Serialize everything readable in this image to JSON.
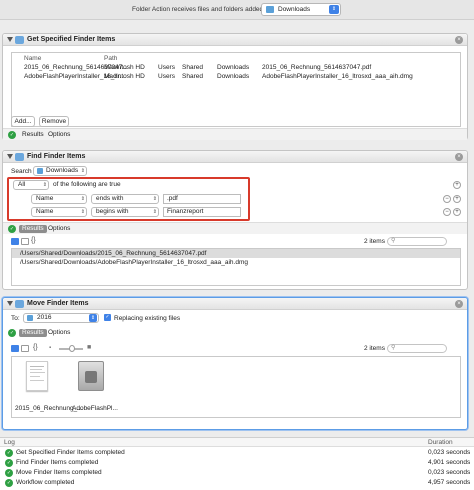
{
  "workflow": {
    "receives_label": "Folder Action receives files and folders added to",
    "receives_target": "Downloads"
  },
  "action1": {
    "title": "Get Specified Finder Items",
    "columns": [
      "Name",
      "Path"
    ],
    "rows": [
      {
        "name": "2015_06_Rechnung_5614637047...",
        "path": [
          "Macintosh HD",
          "Users",
          "Shared",
          "Downloads",
          "2015_06_Rechnung_5614637047.pdf"
        ]
      },
      {
        "name": "AdobeFlashPlayerInstaller_16_ltr...",
        "path": [
          "Macintosh HD",
          "Users",
          "Shared",
          "Downloads",
          "AdobeFlashPlayerInstaller_16_ltrosxd_aaa_aih.dmg"
        ]
      }
    ],
    "add_label": "Add...",
    "remove_label": "Remove",
    "results_tab": "Results",
    "options_tab": "Options"
  },
  "action2": {
    "title": "Find Finder Items",
    "search_label": "Search",
    "search_location": "Downloads",
    "match_mode": "All",
    "match_suffix": "of the following are true",
    "conditions": [
      {
        "field": "Name",
        "op": "ends with",
        "value": ".pdf"
      },
      {
        "field": "Name",
        "op": "begins with",
        "value": "Finanzreport"
      }
    ],
    "results_tab": "Results",
    "options_tab": "Options",
    "items_count": "2 items",
    "result_paths": [
      "/Users/Shared/Downloads/2015_06_Rechnung_5614637047.pdf",
      "/Users/Shared/Downloads/AdobeFlashPlayerInstaller_16_ltrosxd_aaa_aih.dmg"
    ]
  },
  "action3": {
    "title": "Move Finder Items",
    "to_label": "To:",
    "to_folder": "2016",
    "replacing_label": "Replacing existing files",
    "replacing_checked": true,
    "results_tab": "Results",
    "options_tab": "Options",
    "items_count": "2 items",
    "icons": [
      {
        "label": "2015_06_Rechnung_...",
        "kind": "pdf-thumbnail"
      },
      {
        "label": "AdobeFlashPl...",
        "kind": "disk-image"
      }
    ]
  },
  "log": {
    "col_log": "Log",
    "col_duration": "Duration",
    "entries": [
      {
        "text": "Get Specified Finder Items completed",
        "duration": "0,023 seconds"
      },
      {
        "text": "Find Finder Items completed",
        "duration": "4,901 seconds"
      },
      {
        "text": "Move Finder Items completed",
        "duration": "0,023 seconds"
      },
      {
        "text": "Workflow completed",
        "duration": "4,957 seconds"
      }
    ]
  },
  "colors": {
    "accent": "#3f82e7",
    "ok_green": "#2ea043",
    "highlight_red": "#d83a2b"
  }
}
